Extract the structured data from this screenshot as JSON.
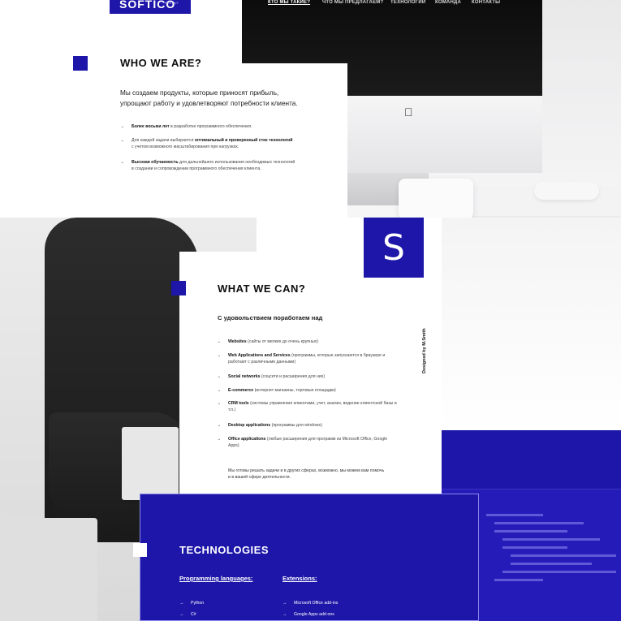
{
  "brand": {
    "logo": "SOFTICO",
    "logo_sub": "REST&IT"
  },
  "nav": {
    "items": [
      {
        "label": "КТО МЫ ТАКИЕ?",
        "active": true
      },
      {
        "label": "ЧТО МЫ ПРЕДЛАГАЕМ?"
      },
      {
        "label": "ТЕХНОЛОГИИ"
      },
      {
        "label": "КОМАНДА"
      },
      {
        "label": "КОНТАКТЫ"
      }
    ]
  },
  "who": {
    "title": "WHO WE ARE?",
    "subtitle_line1": "Мы создаем продукты, которые приносят прибыль,",
    "subtitle_line2": "упрощают работу и удовлетворяют потребности клиента.",
    "bullets": [
      {
        "bold": "Более восьми лет",
        "text": " в разработке программного обеспечения."
      },
      {
        "pre": "Для каждой задачи выбирается ",
        "bold": "оптимальный и проверенный стек технологий",
        "line2": "с учетом возможного масштабирования при нагрузках."
      },
      {
        "bold": "Высокая обучаемость",
        "text": " для дальнейшего использования необходимых технологий",
        "line2": "в создании и сопровождении программного обеспечения клиента."
      }
    ]
  },
  "can": {
    "badge": "S",
    "title": "WHAT WE CAN?",
    "subtitle": "С удовольствием поработаем над",
    "items": [
      {
        "bold": "Websites",
        "text": " (сайты от мелких до очень крупных)"
      },
      {
        "bold": "Web Applications and Services",
        "text": " (программы, которые запускаются в браузере и",
        "line2": "работают с различными данными)"
      },
      {
        "bold": "Social networks",
        "text": " (соцсети и расширения для них)"
      },
      {
        "bold": "E-commerce",
        "text": " (интернет магазины, торговые площадки)"
      },
      {
        "bold": "CRM tools",
        "text": " (системы управления клиентами, учет, анализ, ведение клиентской базы и",
        "line2": "т.п.)"
      },
      {
        "bold": "Desktop applications",
        "text": " (программы для windows)"
      },
      {
        "bold": "Office applications",
        "text": " (любые расширения для программ из Microsoft Office, Google",
        "line2": "Apps)"
      }
    ],
    "footer_line1": "Мы готовы решать задачи и в других сферах, возможно, мы можем вам помочь",
    "footer_line2": "и в вашей сфере деятельности."
  },
  "designed_by": "Designed by M.Smith",
  "tech": {
    "title": "TECHNOLOGIES",
    "programming_title": "Programming languages:",
    "extensions_title": "Extensions:",
    "programming": [
      "Python",
      "C#"
    ],
    "extensions": [
      "Microsoft Office add-ins",
      "Google Apps add-ons"
    ]
  },
  "colors": {
    "accent": "#1d16a8"
  },
  "icons": {
    "arrow": "arrow-right-icon",
    "apple": "apple-logo-icon"
  }
}
